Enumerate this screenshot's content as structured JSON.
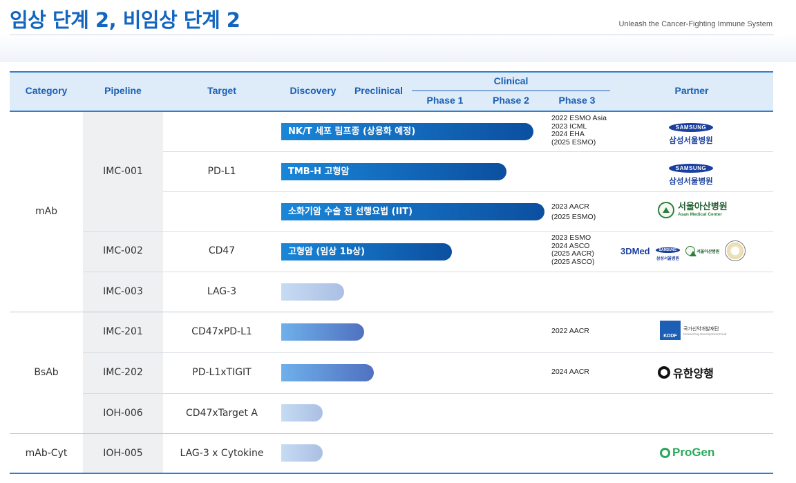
{
  "header": {
    "title": "임상 단계 2, 비임상 단계 2",
    "subtitle": "Unleash the Cancer-Fighting Immune System"
  },
  "columns": {
    "category": "Category",
    "pipeline": "Pipeline",
    "target": "Target",
    "discovery": "Discovery",
    "preclinical": "Preclinical",
    "clinical": "Clinical",
    "phase1": "Phase 1",
    "phase2": "Phase 2",
    "phase3": "Phase 3",
    "partner": "Partner"
  },
  "categories": [
    "mAb",
    "BsAb",
    "mAb-Cyt"
  ],
  "rows": [
    {
      "pipeline": "IMC-001",
      "target": "PD-L1",
      "stage_fraction": 0.0,
      "bars": [
        {
          "label": "NK/T 세포 림프종 (상용화 예정)",
          "stage": "Phase 3 (mid)",
          "notes": [
            "2022 ESMO Asia",
            "2023 ICML",
            "2024 EHA",
            "(2025 ESMO)"
          ],
          "partner": "samsung"
        },
        {
          "label": "TMB-H 고형암",
          "stage": "Phase 2 (end)",
          "notes": [],
          "partner": "samsung"
        },
        {
          "label": "소화기암 수술 전 선행요법 (IIT)",
          "stage": "Phase 3 (start)",
          "notes": [
            "2023 AACR",
            "(2025 ESMO)"
          ],
          "partner": "asan"
        }
      ]
    },
    {
      "pipeline": "IMC-002",
      "target": "CD47",
      "bars": [
        {
          "label": "고형암 (임상 1b상)",
          "stage": "Phase 1 (end)",
          "notes": [
            "2023 ESMO",
            "2024 ASCO",
            "(2025 AACR)",
            "(2025 ASCO)"
          ],
          "partner": "3dmed-samsung-asan-seal"
        }
      ]
    },
    {
      "pipeline": "IMC-003",
      "target": "LAG-3",
      "bars": [
        {
          "label": "",
          "stage": "Discovery",
          "notes": []
        }
      ]
    },
    {
      "pipeline": "IMC-201",
      "target": "CD47xPD-L1",
      "bars": [
        {
          "label": "",
          "stage": "Preclinical",
          "notes": [
            "2022 AACR"
          ],
          "partner": "kddf"
        }
      ]
    },
    {
      "pipeline": "IMC-202",
      "target": "PD-L1xTIGIT",
      "bars": [
        {
          "label": "",
          "stage": "Preclinical",
          "notes": [
            "2024 AACR"
          ],
          "partner": "yuhan"
        }
      ]
    },
    {
      "pipeline": "IOH-006",
      "target": "CD47xTarget A",
      "bars": [
        {
          "label": "",
          "stage": "Discovery",
          "notes": []
        }
      ]
    },
    {
      "pipeline": "IOH-005",
      "target": "LAG-3 x Cytokine",
      "bars": [
        {
          "label": "",
          "stage": "Discovery",
          "notes": []
        }
      ],
      "partner": "progen"
    }
  ],
  "partners": {
    "samsung_en": "SAMSUNG",
    "samsung_ko": "삼성서울병원",
    "asan_ko": "서울아산병원",
    "asan_en": "Asan Medical Center",
    "med3d": "3DMed",
    "kddf_en": "KDDF",
    "kddf_ko": "국가신약개발재단",
    "kddf_sub": "Korea Drug Development Fund",
    "yuhan": "유한양행",
    "progen": "ProGen"
  },
  "colors": {
    "accent": "#1266c0",
    "header_bg": "#deebf8",
    "bar_solid_start": "#1a86d8",
    "bar_solid_end": "#0c4fa0",
    "bar_pale": "#c6dcf3",
    "pipeline_bg": "#eef0f2"
  }
}
